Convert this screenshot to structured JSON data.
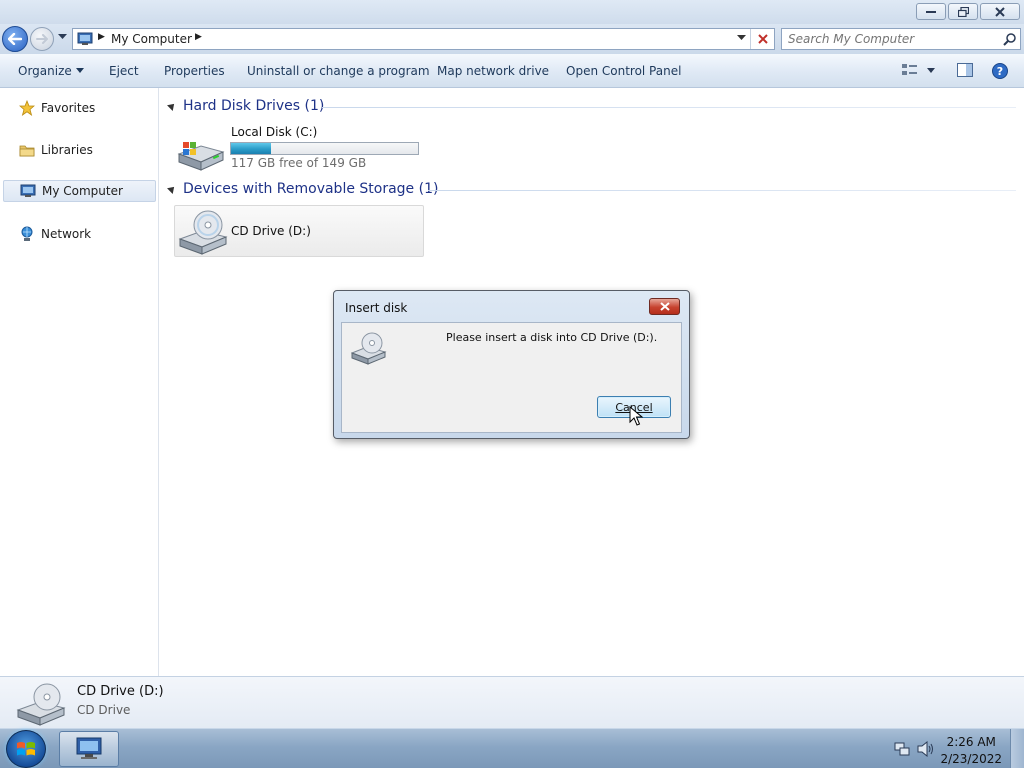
{
  "window": {
    "controls": [
      "minimize",
      "restore",
      "close"
    ]
  },
  "address": {
    "path": [
      "My Computer"
    ],
    "search_placeholder": "Search My Computer"
  },
  "toolbar": {
    "organize": "Organize",
    "eject": "Eject",
    "properties": "Properties",
    "uninstall": "Uninstall or change a program",
    "map_drive": "Map network drive",
    "control_panel": "Open Control Panel"
  },
  "sidebar": {
    "items": [
      {
        "label": "Favorites",
        "icon": "star-icon"
      },
      {
        "label": "Libraries",
        "icon": "folder-icon"
      },
      {
        "label": "My Computer",
        "icon": "computer-icon",
        "selected": true
      },
      {
        "label": "Network",
        "icon": "network-icon"
      }
    ]
  },
  "groups": {
    "hard_disks": {
      "title": "Hard Disk Drives (1)",
      "drive": {
        "name": "Local Disk (C:)",
        "free_text": "117 GB free of 149 GB",
        "used_fraction": 0.215
      }
    },
    "removable": {
      "title": "Devices with Removable Storage (1)",
      "drive": {
        "name": "CD Drive (D:)"
      }
    }
  },
  "dialog": {
    "title": "Insert disk",
    "message": "Please insert a disk into CD Drive (D:).",
    "cancel": "Cancel"
  },
  "details": {
    "name": "CD Drive (D:)",
    "type": "CD Drive"
  },
  "taskbar": {
    "time": "2:26 AM",
    "date": "2/23/2022"
  },
  "colors": {
    "group_header": "#1e3287",
    "usage_bar": "#2b9cc8",
    "dialog_close": "#c7432f"
  }
}
